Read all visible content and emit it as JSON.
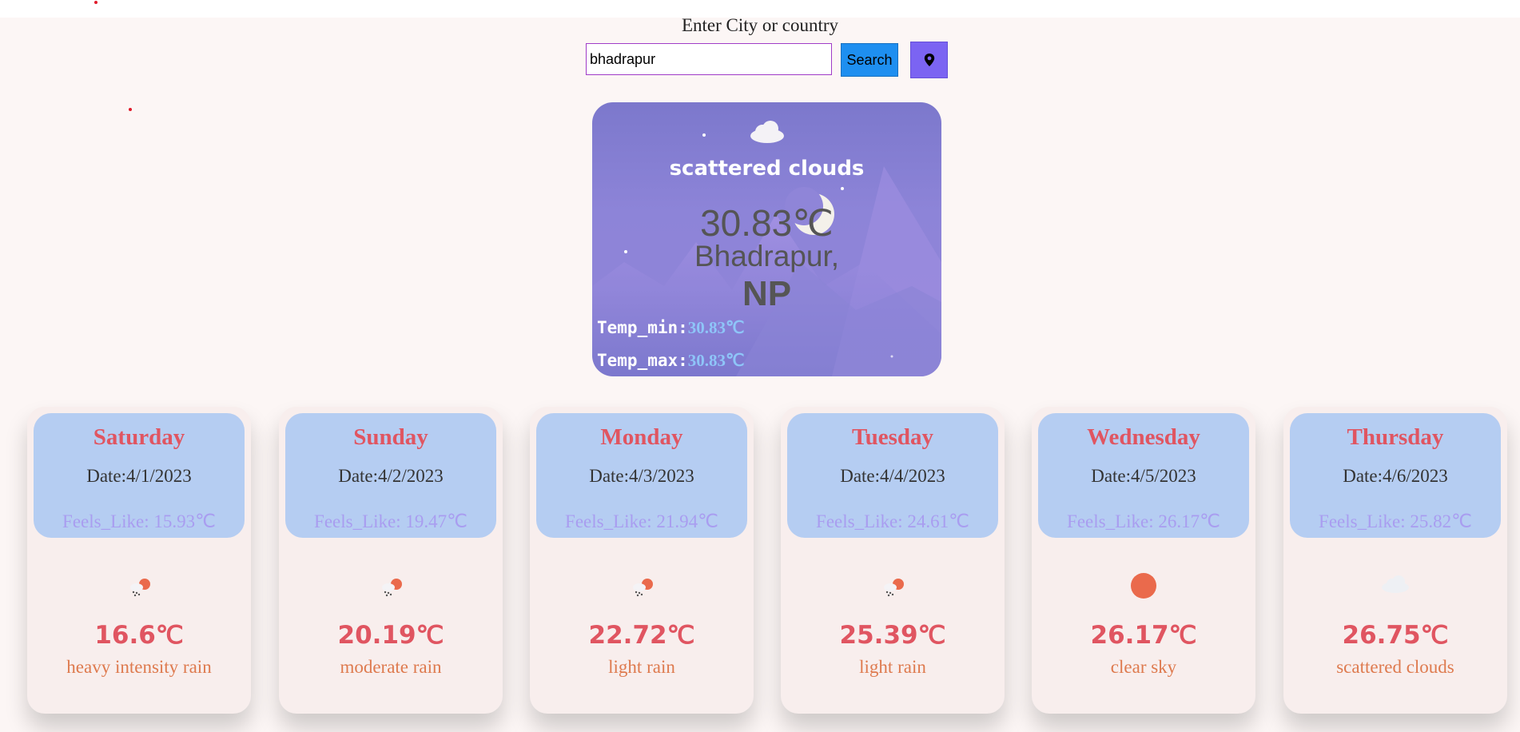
{
  "search": {
    "label": "Enter City or country",
    "value": "bhadrapur",
    "button_label": "Search",
    "location_icon": "map-pin-icon"
  },
  "current": {
    "icon": "cloud-icon",
    "description": "scattered clouds",
    "temp": "30.83",
    "unit": "℃",
    "city": "Bhadrapur,",
    "country": "NP",
    "temp_min_label": "Temp_min:",
    "temp_min_value": "30.83℃",
    "temp_max_label": "Temp_max:",
    "temp_max_value": "30.83℃"
  },
  "forecast": [
    {
      "day": "Saturday",
      "date": "Date:4/1/2023",
      "feels_like": "Feels_Like: 15.93℃",
      "icon": "rain-sun-icon",
      "temp": "16.6",
      "unit": "℃",
      "description": "heavy intensity rain"
    },
    {
      "day": "Sunday",
      "date": "Date:4/2/2023",
      "feels_like": "Feels_Like: 19.47℃",
      "icon": "rain-sun-icon",
      "temp": "20.19",
      "unit": "℃",
      "description": "moderate rain"
    },
    {
      "day": "Monday",
      "date": "Date:4/3/2023",
      "feels_like": "Feels_Like: 21.94℃",
      "icon": "rain-sun-icon",
      "temp": "22.72",
      "unit": "℃",
      "description": "light rain"
    },
    {
      "day": "Tuesday",
      "date": "Date:4/4/2023",
      "feels_like": "Feels_Like: 24.61℃",
      "icon": "rain-sun-icon",
      "temp": "25.39",
      "unit": "℃",
      "description": "light rain"
    },
    {
      "day": "Wednesday",
      "date": "Date:4/5/2023",
      "feels_like": "Feels_Like: 26.17℃",
      "icon": "sun-icon",
      "temp": "26.17",
      "unit": "℃",
      "description": "clear sky"
    },
    {
      "day": "Thursday",
      "date": "Date:4/6/2023",
      "feels_like": "Feels_Like: 25.82℃",
      "icon": "cloud-icon",
      "temp": "26.75",
      "unit": "℃",
      "description": "scattered clouds"
    }
  ],
  "colors": {
    "background": "#fcf6f5",
    "card_gradient": "#8d84d8",
    "forecast_head": "#b5cdf2",
    "accent_red": "#e05561",
    "desc_orange": "#de7a4e",
    "feels_purple": "#a99df0",
    "search_button": "#1e8ff0",
    "location_button": "#7b64f2"
  }
}
